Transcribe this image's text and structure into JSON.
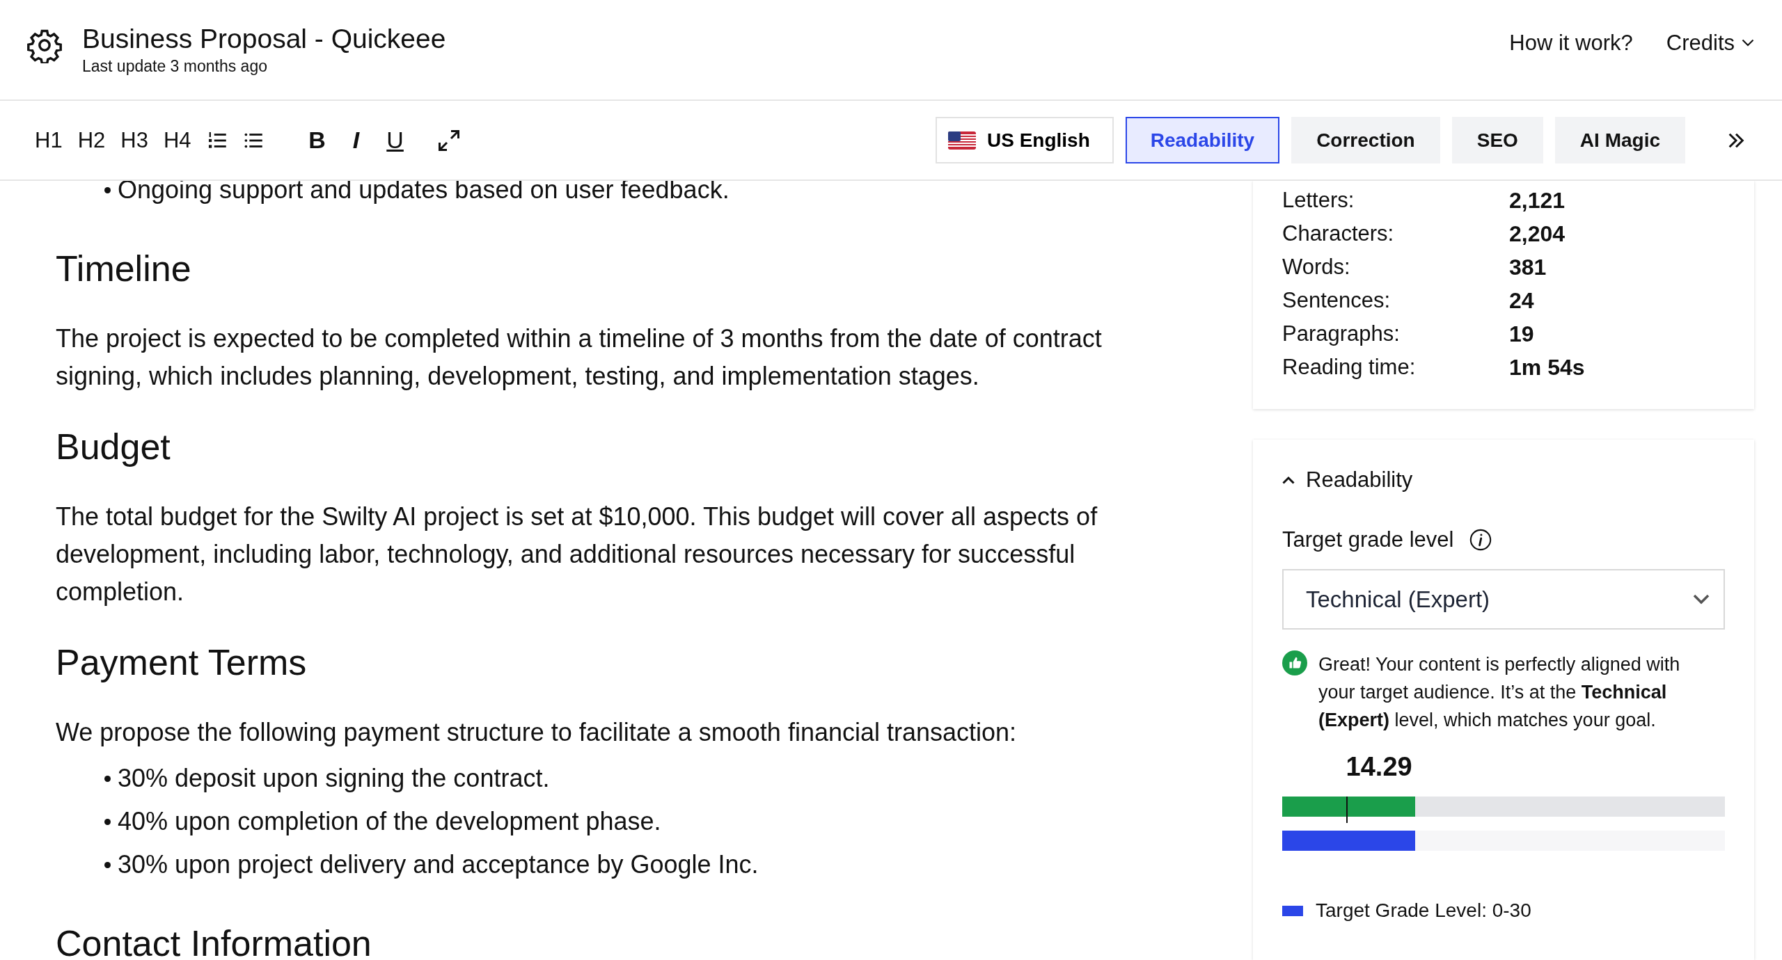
{
  "header": {
    "title": "Business Proposal - Quickeee",
    "subtitle": "Last update 3 months ago",
    "links": [
      {
        "label": "How it work?",
        "kind": "link"
      },
      {
        "label": "Credits",
        "kind": "dropdown"
      }
    ]
  },
  "toolbar": {
    "headings": [
      "H1",
      "H2",
      "H3",
      "H4"
    ],
    "formats": [
      {
        "label": "B",
        "kind": "bold"
      },
      {
        "label": "I",
        "kind": "italic"
      },
      {
        "label": "U",
        "kind": "underline"
      }
    ],
    "language": "US English",
    "tabs": [
      {
        "label": "Readability",
        "selected": true
      },
      {
        "label": "Correction",
        "selected": false
      },
      {
        "label": "SEO",
        "selected": false
      },
      {
        "label": "AI Magic",
        "selected": false
      }
    ]
  },
  "document": [
    {
      "kind": "bullets",
      "items": [
        "Ongoing support and updates based on user feedback."
      ]
    },
    {
      "kind": "heading",
      "text": "Timeline"
    },
    {
      "kind": "paragraph",
      "text": "The project is expected to be completed within a timeline of 3 months from the date of contract signing, which includes planning, development, testing, and implementation stages."
    },
    {
      "kind": "heading",
      "text": "Budget"
    },
    {
      "kind": "paragraph",
      "text": "The total budget for the Swilty AI project is set at $10,000. This budget will cover all aspects of development, including labor, technology, and additional resources necessary for successful completion."
    },
    {
      "kind": "heading",
      "text": "Payment Terms"
    },
    {
      "kind": "paragraph",
      "text": "We propose the following payment structure to facilitate a smooth financial transaction:"
    },
    {
      "kind": "bullets",
      "items": [
        "30% deposit upon signing the contract.",
        "40% upon completion of the development phase.",
        "30% upon project delivery and acceptance by Google Inc."
      ]
    },
    {
      "kind": "heading",
      "text": "Contact Information"
    }
  ],
  "stats": [
    {
      "label": "Letters:",
      "value": "2,121"
    },
    {
      "label": "Characters:",
      "value": "2,204"
    },
    {
      "label": "Words:",
      "value": "381"
    },
    {
      "label": "Sentences:",
      "value": "24"
    },
    {
      "label": "Paragraphs:",
      "value": "19"
    },
    {
      "label": "Reading time:",
      "value": "1m 54s"
    }
  ],
  "readability": {
    "title": "Readability",
    "expanded": true,
    "target_label": "Target grade level",
    "target_value": "Technical (Expert)",
    "message": "Great! Your content is perfectly aligned with your target audience. It’s at the **Technical (Expert)** level, which matches your goal.",
    "score": "14.29",
    "score_bar": {
      "level": 0.3
    },
    "marker": {
      "level": 0.144
    },
    "target_bar": {
      "level": 0.3
    },
    "legend": "Target Grade Level: 0-30"
  }
}
